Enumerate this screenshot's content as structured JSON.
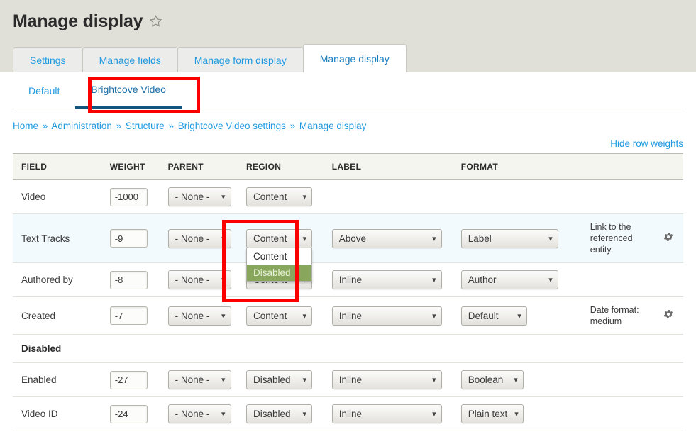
{
  "header": {
    "title": "Manage display",
    "star_icon": "star-outline-icon"
  },
  "primary_tabs": [
    {
      "label": "Settings",
      "active": false
    },
    {
      "label": "Manage fields",
      "active": false
    },
    {
      "label": "Manage form display",
      "active": false
    },
    {
      "label": "Manage display",
      "active": true
    }
  ],
  "secondary_tabs": [
    {
      "label": "Default",
      "active": false
    },
    {
      "label": "Brightcove Video",
      "active": true
    }
  ],
  "breadcrumb": {
    "separator": "»",
    "items": [
      "Home",
      "Administration",
      "Structure",
      "Brightcove Video settings",
      "Manage display"
    ]
  },
  "row_weights_link": "Hide row weights",
  "table": {
    "headers": [
      "FIELD",
      "WEIGHT",
      "PARENT",
      "REGION",
      "LABEL",
      "FORMAT"
    ],
    "rows": [
      {
        "type": "field",
        "field": "Video",
        "weight": "-1000",
        "parent": "- None -",
        "region": "Content",
        "label": "",
        "format": "",
        "summary": "",
        "gear": false,
        "highlight": false
      },
      {
        "type": "field",
        "field": "Text Tracks",
        "weight": "-9",
        "parent": "- None -",
        "region": "Content",
        "label": "Above",
        "format": "Label",
        "summary": "Link to the referenced entity",
        "gear": true,
        "highlight": true,
        "region_open": true,
        "region_options": [
          {
            "label": "Content",
            "selected": false
          },
          {
            "label": "Disabled",
            "selected": true
          }
        ]
      },
      {
        "type": "field",
        "field": "Authored by",
        "weight": "-8",
        "parent": "- None -",
        "region": "Content",
        "label": "Inline",
        "format": "Author",
        "summary": "",
        "gear": false,
        "highlight": false
      },
      {
        "type": "field",
        "field": "Created",
        "weight": "-7",
        "parent": "- None -",
        "region": "Content",
        "label": "Inline",
        "format": "Default",
        "summary": "Date format: medium",
        "gear": true,
        "highlight": false
      },
      {
        "type": "region",
        "field": "Disabled"
      },
      {
        "type": "field",
        "field": "Enabled",
        "weight": "-27",
        "parent": "- None -",
        "region": "Disabled",
        "label": "Inline",
        "format": "Boolean",
        "summary": "",
        "gear": false,
        "highlight": false
      },
      {
        "type": "field",
        "field": "Video ID",
        "weight": "-24",
        "parent": "- None -",
        "region": "Disabled",
        "label": "Inline",
        "format": "Plain text",
        "summary": "",
        "gear": false,
        "highlight": false
      }
    ]
  },
  "icons": {
    "caret": "⌄",
    "gear": "gear-icon"
  },
  "colors": {
    "link": "#1f9ae0",
    "header_band": "#e0e0d8",
    "highlight_red": "#fc0000",
    "option_selected_green": "#88a75c",
    "row_highlight": "#f3fafd",
    "active_underline": "#11557f"
  }
}
